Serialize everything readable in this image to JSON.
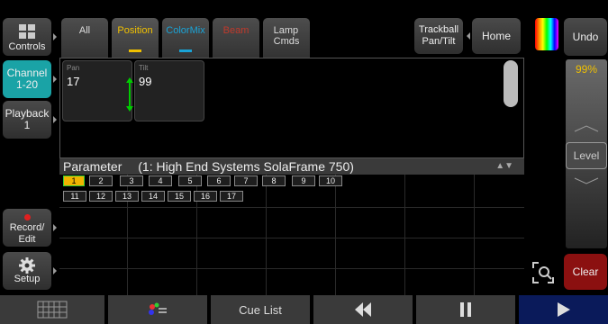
{
  "sidebar": {
    "controls_label": "Controls",
    "channel_label": "Channel\n1-20",
    "playback_label": "Playback\n1",
    "record_label": "Record/\nEdit",
    "setup_label": "Setup"
  },
  "tabs": [
    {
      "label": "All"
    },
    {
      "label": "Position"
    },
    {
      "label": "ColorMix"
    },
    {
      "label": "Beam"
    },
    {
      "label": "Lamp\nCmds"
    }
  ],
  "header": {
    "trackball_label": "Trackball\nPan/Tilt",
    "home_label": "Home",
    "undo_label": "Undo"
  },
  "parameters": [
    {
      "name": "Pan",
      "value": "17"
    },
    {
      "name": "Tilt",
      "value": "99"
    }
  ],
  "param_header": {
    "title": "Parameter",
    "fixture": "(1: High End Systems SolaFrame 750)"
  },
  "channels": [
    "1",
    "2",
    "3",
    "4",
    "5",
    "6",
    "7",
    "8",
    "9",
    "10",
    "11",
    "12",
    "13",
    "14",
    "15",
    "16",
    "17"
  ],
  "selected_channel": "1",
  "level": {
    "percent": "99%",
    "label": "Level"
  },
  "clear_label": "Clear",
  "bottom_bar": {
    "cue_list_label": "Cue List"
  },
  "colors": {
    "accent_teal": "#1aa3a6",
    "position_text": "#f0c000",
    "colormix_text": "#1aa3d6",
    "beam_text": "#c0392b",
    "clear_red": "#8b1010",
    "selected_channel": "#f0b400"
  }
}
